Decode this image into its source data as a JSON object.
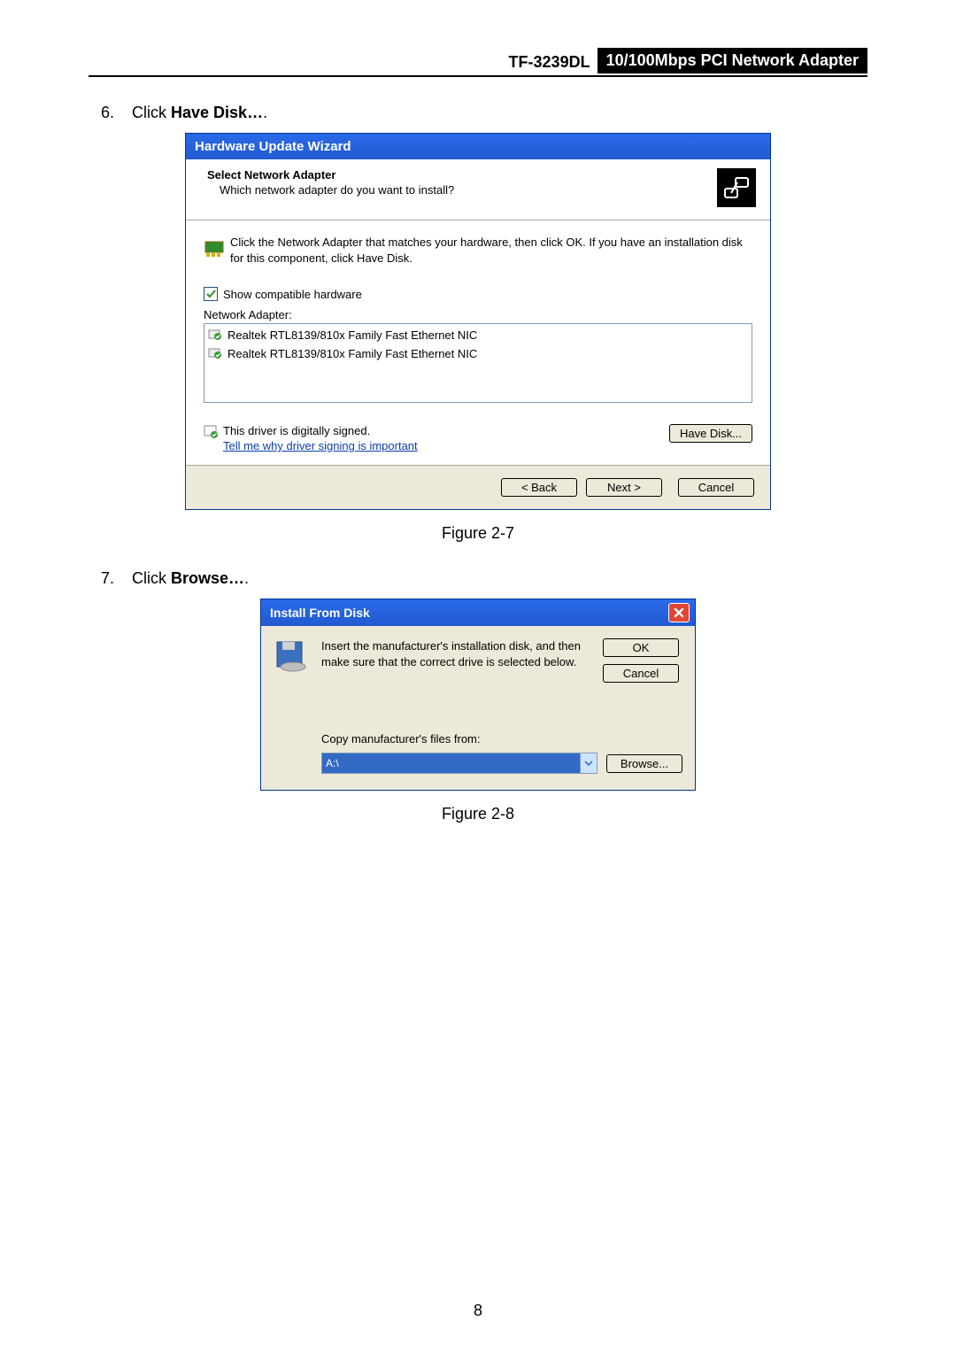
{
  "header": {
    "model": "TF-3239DL",
    "subtitle": "10/100Mbps PCI Network Adapter"
  },
  "steps": {
    "s6": {
      "num": "6.",
      "prefix": "Click ",
      "bold": "Have Disk…",
      "suffix": "."
    },
    "s7": {
      "num": "7.",
      "prefix": "Click ",
      "bold": "Browse…",
      "suffix": "."
    }
  },
  "dlg1": {
    "title": "Hardware Update Wizard",
    "header_title": "Select Network Adapter",
    "header_sub": "Which network adapter do you want to install?",
    "info": "Click the Network Adapter that matches your hardware, then click OK. If you have an installation disk for this component, click Have Disk.",
    "show_compat": "Show compatible hardware",
    "list_label": "Network Adapter:",
    "adapters": [
      "Realtek RTL8139/810x Family Fast Ethernet NIC",
      "Realtek RTL8139/810x Family Fast Ethernet NIC"
    ],
    "signed_text": "This driver is digitally signed.",
    "signed_link": "Tell me why driver signing is important",
    "have_disk": "Have Disk...",
    "back": "< Back",
    "next": "Next >",
    "cancel": "Cancel"
  },
  "dlg2": {
    "title": "Install From Disk",
    "msg": "Insert the manufacturer's installation disk, and then make sure that the correct drive is selected below.",
    "ok": "OK",
    "cancel": "Cancel",
    "copy_label": "Copy manufacturer's files from:",
    "path": "A:\\",
    "browse": "Browse..."
  },
  "captions": {
    "fig27": "Figure 2-7",
    "fig28": "Figure 2-8"
  },
  "page_number": "8"
}
